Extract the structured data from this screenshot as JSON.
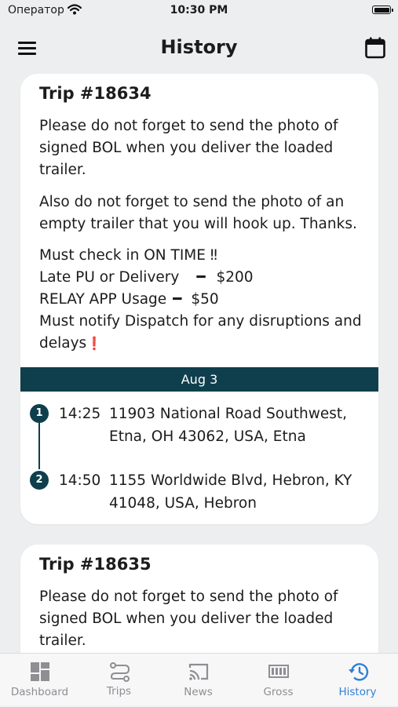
{
  "status_bar": {
    "carrier": "Оператор",
    "time": "10:30 PM"
  },
  "header": {
    "title": "History"
  },
  "trips": [
    {
      "title": "Trip #18634",
      "messages": [
        "Please do not forget to send the photo of signed BOL when you deliver the loaded trailer.",
        "Also do not forget to send the photo of an empty trailer that you will hook up. Thanks."
      ],
      "notes": {
        "check_in": "Must check in ON TIME ‼",
        "late_label": "Late PU or Delivery",
        "late_amount": "$200",
        "relay_label": "RELAY APP Usage",
        "relay_amount": "$50",
        "notify": "Must notify Dispatch for any disruptions and delays",
        "dash": "━",
        "exclaim": "❗"
      },
      "date": "Aug 3",
      "stops": [
        {
          "num": "1",
          "time": "14:25",
          "address": "11903 National Road Southwest, Etna, OH 43062, USA, Etna"
        },
        {
          "num": "2",
          "time": "14:50",
          "address": "1155 Worldwide Blvd, Hebron, KY 41048, USA, Hebron"
        }
      ]
    },
    {
      "title": "Trip #18635",
      "messages": [
        "Please do not forget to send the photo of signed BOL when you deliver the loaded trailer."
      ]
    }
  ],
  "tab_bar": {
    "tabs": [
      {
        "label": "Dashboard",
        "icon": "dashboard-icon",
        "active": false
      },
      {
        "label": "Trips",
        "icon": "route-icon",
        "active": false
      },
      {
        "label": "News",
        "icon": "cast-icon",
        "active": false
      },
      {
        "label": "Gross",
        "icon": "gross-icon",
        "active": false
      },
      {
        "label": "History",
        "icon": "history-icon",
        "active": true
      }
    ],
    "active_color": "#2f80d8",
    "inactive_color": "#8e8e93"
  },
  "colors": {
    "accent": "#0f3f4d",
    "background": "#eceeef",
    "card": "#ffffff",
    "alert": "#e02020"
  }
}
